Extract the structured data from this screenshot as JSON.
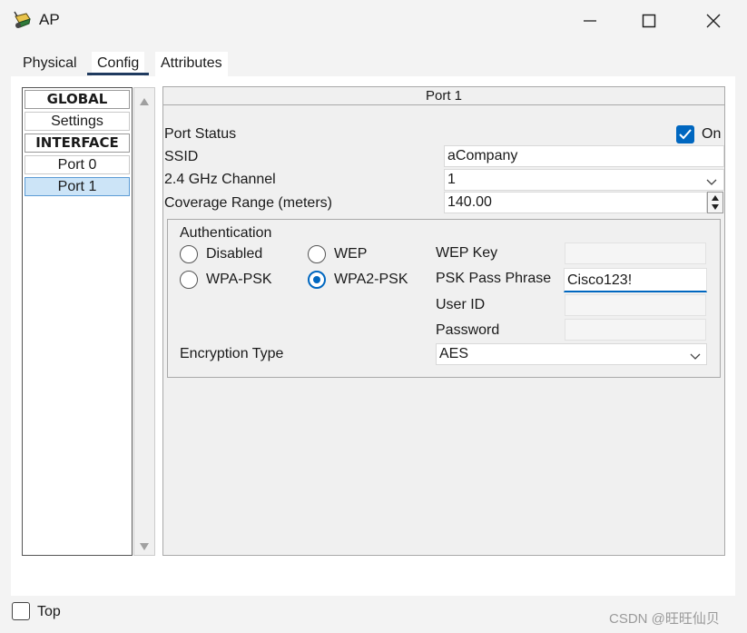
{
  "window": {
    "title": "AP"
  },
  "tabs": [
    {
      "label": "Physical"
    },
    {
      "label": "Config"
    },
    {
      "label": "Attributes"
    }
  ],
  "sidebar": {
    "items": [
      {
        "label": "GLOBAL"
      },
      {
        "label": "Settings"
      },
      {
        "label": "INTERFACE"
      },
      {
        "label": "Port 0"
      },
      {
        "label": "Port 1"
      }
    ]
  },
  "panel": {
    "header": "Port 1",
    "port_status_label": "Port Status",
    "port_status_value": "On",
    "ssid_label": "SSID",
    "ssid_value": "aCompany",
    "channel_label": "2.4 GHz Channel",
    "channel_value": "1",
    "coverage_label": "Coverage Range (meters)",
    "coverage_value": "140.00"
  },
  "auth": {
    "group_label": "Authentication",
    "options": [
      {
        "label": "Disabled"
      },
      {
        "label": "WEP"
      },
      {
        "label": "WPA-PSK"
      },
      {
        "label": "WPA2-PSK"
      }
    ],
    "wep_key_label": "WEP Key",
    "psk_label": "PSK Pass Phrase",
    "psk_value": "Cisco123!",
    "userid_label": "User ID",
    "password_label": "Password",
    "encryption_label": "Encryption Type",
    "encryption_value": "AES"
  },
  "footer": {
    "top_label": "Top",
    "watermark": "CSDN @旺旺仙贝"
  },
  "colors": {
    "accent": "#0067c0",
    "selected": "#cce4f7",
    "tab_underline": "#1f3a5f"
  }
}
